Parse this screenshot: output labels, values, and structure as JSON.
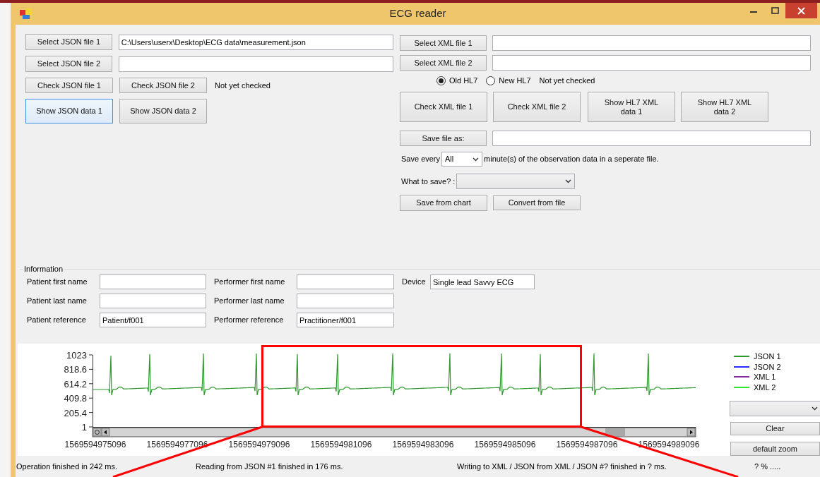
{
  "window": {
    "title": "ECG reader"
  },
  "json_files": [
    {
      "button": "Select JSON file 1",
      "path": "C:\\Users\\userx\\Desktop\\ECG data\\measurement.json"
    },
    {
      "button": "Select JSON file 2"
    }
  ],
  "json_check": {
    "buttons": [
      "Check JSON file 1",
      "Check JSON file 2"
    ],
    "status": "Not yet checked"
  },
  "json_show_buttons": [
    {
      "label": "Show JSON data 1",
      "focused": true
    },
    {
      "label": "Show JSON data 2",
      "focused": false
    }
  ],
  "xml_files": [
    {
      "button": "Select XML file 1"
    },
    {
      "button": "Select XML file 2"
    }
  ],
  "hl7_versions": [
    {
      "label": "Old HL7",
      "selected": true
    },
    {
      "label": "New HL7",
      "selected": false
    }
  ],
  "xml_status": "Not yet checked",
  "xml_buttons": [
    "Check XML file 1",
    "Check XML file 2",
    "Show HL7 XML data 1",
    "Show HL7 XML data 2"
  ],
  "save_file": {
    "button": "Save file as:"
  },
  "save_every": {
    "label": "Save every",
    "value": "All",
    "suffix": "minute(s) of the observation data in a seperate file."
  },
  "what_to_save": {
    "label": "What to save? :"
  },
  "save_buttons": [
    "Save from chart",
    "Convert from file"
  ],
  "information": {
    "title": "Information",
    "columns": [
      [
        {
          "label": "Patient first name"
        },
        {
          "label": "Patient last name"
        },
        {
          "label": "Patient reference",
          "value": "Patient/f001"
        }
      ],
      [
        {
          "label": "Performer first name"
        },
        {
          "label": "Performer last name"
        },
        {
          "label": "Performer reference",
          "value": "Practitioner/f001"
        }
      ],
      [
        {
          "label": "Device",
          "value": "Single lead Savvy ECG"
        }
      ]
    ]
  },
  "chart": {
    "y_tick_labels": [
      "1023",
      "818.6",
      "614.2",
      "409.8",
      "205.4",
      "1"
    ],
    "x_tick_labels": [
      "1569594975096",
      "1569594977096",
      "1569594979096",
      "1569594981096",
      "1569594983096",
      "1569594985096",
      "1569594987096",
      "1569594989096"
    ],
    "legend": [
      {
        "label": "JSON 1",
        "color": "#2f9a2f"
      },
      {
        "label": "JSON 2",
        "color": "#2a2aff"
      },
      {
        "label": "XML 1",
        "color": "#8a2ba0"
      },
      {
        "label": "XML 2",
        "color": "#2ee62e"
      }
    ]
  },
  "chart_buttons": [
    "Clear",
    "default zoom"
  ],
  "status_bar": [
    "Operation finished in 242 ms.",
    "Reading from JSON #1 finished in 176 ms.",
    "Writing to XML / JSON from XML / JSON #? finished in ? ms.",
    "? % ....."
  ]
}
